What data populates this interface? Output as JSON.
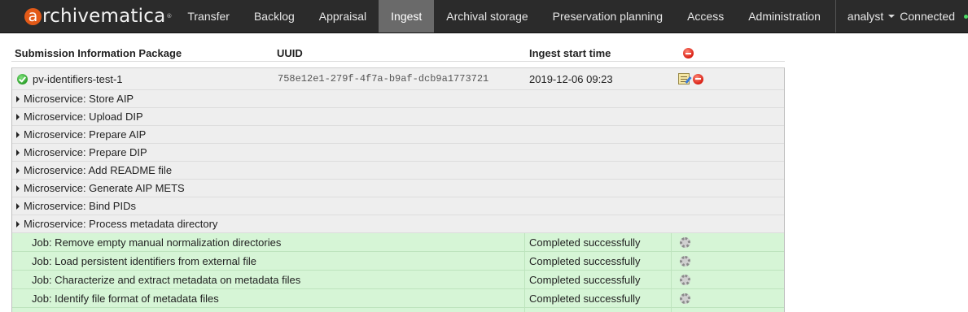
{
  "brand": {
    "first_letter": "a",
    "rest": "rchivematica",
    "reg": "®"
  },
  "nav": {
    "items": [
      {
        "label": "Transfer"
      },
      {
        "label": "Backlog"
      },
      {
        "label": "Appraisal"
      },
      {
        "label": "Ingest"
      },
      {
        "label": "Archival storage"
      },
      {
        "label": "Preservation planning"
      },
      {
        "label": "Access"
      },
      {
        "label": "Administration"
      }
    ],
    "active": "Ingest",
    "user": "analyst",
    "status": "Connected",
    "status_color": "#4cd964"
  },
  "table": {
    "headers": {
      "sip": "Submission Information Package",
      "uuid": "UUID",
      "start": "Ingest start time"
    },
    "sip": {
      "name": "pv-identifiers-test-1",
      "uuid": "758e12e1-279f-4f7a-b9af-dcb9a1773721",
      "start_time": "2019-12-06 09:23"
    },
    "microservices": [
      "Microservice: Store AIP",
      "Microservice: Upload DIP",
      "Microservice: Prepare AIP",
      "Microservice: Prepare DIP",
      "Microservice: Add README file",
      "Microservice: Generate AIP METS",
      "Microservice: Bind PIDs",
      "Microservice: Process metadata directory"
    ],
    "jobs": [
      {
        "name": "Job: Remove empty manual normalization directories",
        "status": "Completed successfully"
      },
      {
        "name": "Job: Load persistent identifiers from external file",
        "status": "Completed successfully"
      },
      {
        "name": "Job: Characterize and extract metadata on metadata files",
        "status": "Completed successfully"
      },
      {
        "name": "Job: Identify file format of metadata files",
        "status": "Completed successfully"
      }
    ]
  },
  "colors": {
    "navbar_bg": "#2b2b2b",
    "active_tab_bg": "#6a6a6a",
    "brand_accent": "#e35a18",
    "job_success_bg": "#d6f5d6"
  }
}
